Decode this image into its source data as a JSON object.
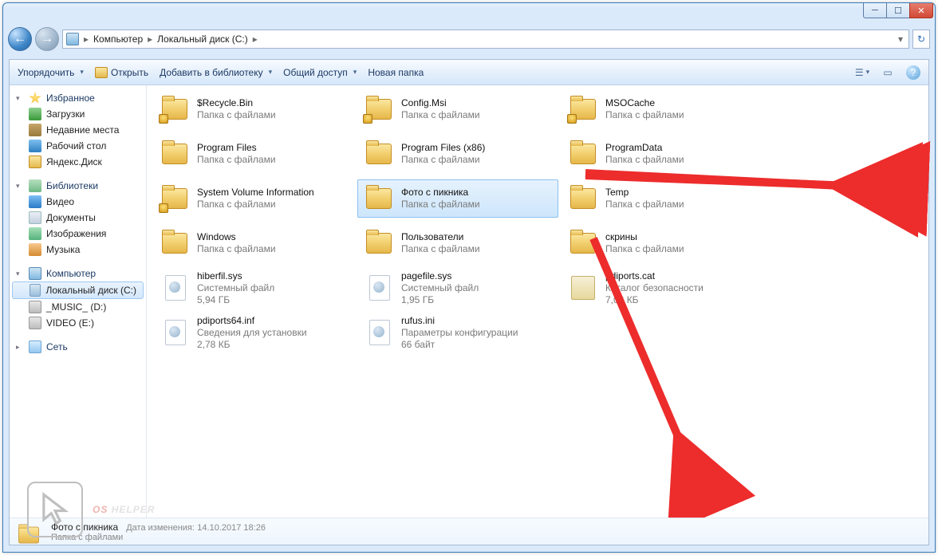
{
  "window": {
    "nav": {
      "crumbs": [
        "Компьютер",
        "Локальный диск (C:)"
      ],
      "sep": "▸"
    },
    "controls": {
      "min": "─",
      "max": "☐",
      "close": "✕"
    }
  },
  "toolbar": {
    "organize": "Упорядочить",
    "open": "Открыть",
    "add_library": "Добавить в библиотеку",
    "share": "Общий доступ",
    "new_folder": "Новая папка"
  },
  "sidebar": {
    "favorites": {
      "label": "Избранное",
      "items": [
        {
          "icon": "dl",
          "label": "Загрузки"
        },
        {
          "icon": "recent",
          "label": "Недавние места"
        },
        {
          "icon": "desk",
          "label": "Рабочий стол"
        },
        {
          "icon": "yd",
          "label": "Яндекс.Диск"
        }
      ]
    },
    "libraries": {
      "label": "Библиотеки",
      "items": [
        {
          "icon": "vid",
          "label": "Видео"
        },
        {
          "icon": "doc",
          "label": "Документы"
        },
        {
          "icon": "img",
          "label": "Изображения"
        },
        {
          "icon": "mus",
          "label": "Музыка"
        }
      ]
    },
    "computer": {
      "label": "Компьютер",
      "items": [
        {
          "icon": "disk",
          "label": "Локальный диск (C:)",
          "selected": true
        },
        {
          "icon": "disk2",
          "label": "_MUSIC_ (D:)"
        },
        {
          "icon": "disk2",
          "label": "VIDEO (E:)"
        }
      ]
    },
    "network": {
      "label": "Сеть"
    }
  },
  "files": {
    "folder_sub": "Папка с файлами",
    "items": [
      {
        "col": 0,
        "kind": "folder",
        "locked": true,
        "name": "$Recycle.Bin"
      },
      {
        "col": 1,
        "kind": "folder",
        "locked": true,
        "name": "Config.Msi"
      },
      {
        "col": 2,
        "kind": "folder",
        "locked": true,
        "name": "MSOCache"
      },
      {
        "col": 0,
        "kind": "folder",
        "name": "Program Files"
      },
      {
        "col": 1,
        "kind": "folder",
        "name": "Program Files (x86)"
      },
      {
        "col": 2,
        "kind": "folder",
        "name": "ProgramData"
      },
      {
        "col": 0,
        "kind": "folder",
        "locked": true,
        "name": "System Volume Information"
      },
      {
        "col": 1,
        "kind": "folder",
        "name": "Фото с пикника",
        "selected": true
      },
      {
        "col": 2,
        "kind": "folder",
        "name": "Temp"
      },
      {
        "col": 0,
        "kind": "folder",
        "name": "Windows"
      },
      {
        "col": 1,
        "kind": "folder",
        "name": "Пользователи"
      },
      {
        "col": 2,
        "kind": "folder",
        "name": "скрины"
      },
      {
        "col": 0,
        "kind": "sys",
        "name": "hiberfil.sys",
        "sub1": "Системный файл",
        "sub2": "5,94 ГБ"
      },
      {
        "col": 1,
        "kind": "sys",
        "name": "pagefile.sys",
        "sub1": "Системный файл",
        "sub2": "1,95 ГБ"
      },
      {
        "col": 2,
        "kind": "cat",
        "name": "pdiports.cat",
        "sub1": "Каталог безопасности",
        "sub2": "7,06 КБ"
      },
      {
        "col": 0,
        "kind": "sys",
        "name": "pdiports64.inf",
        "sub1": "Сведения для установки",
        "sub2": "2,78 КБ"
      },
      {
        "col": 1,
        "kind": "sys",
        "name": "rufus.ini",
        "sub1": "Параметры конфигурации",
        "sub2": "66 байт"
      }
    ]
  },
  "details": {
    "name": "Фото с пикника",
    "date_label": "Дата изменения:",
    "date": "14.10.2017 18:26",
    "type": "Папка с файлами"
  },
  "watermark": {
    "os": "OS",
    "rest": "HELPER"
  }
}
